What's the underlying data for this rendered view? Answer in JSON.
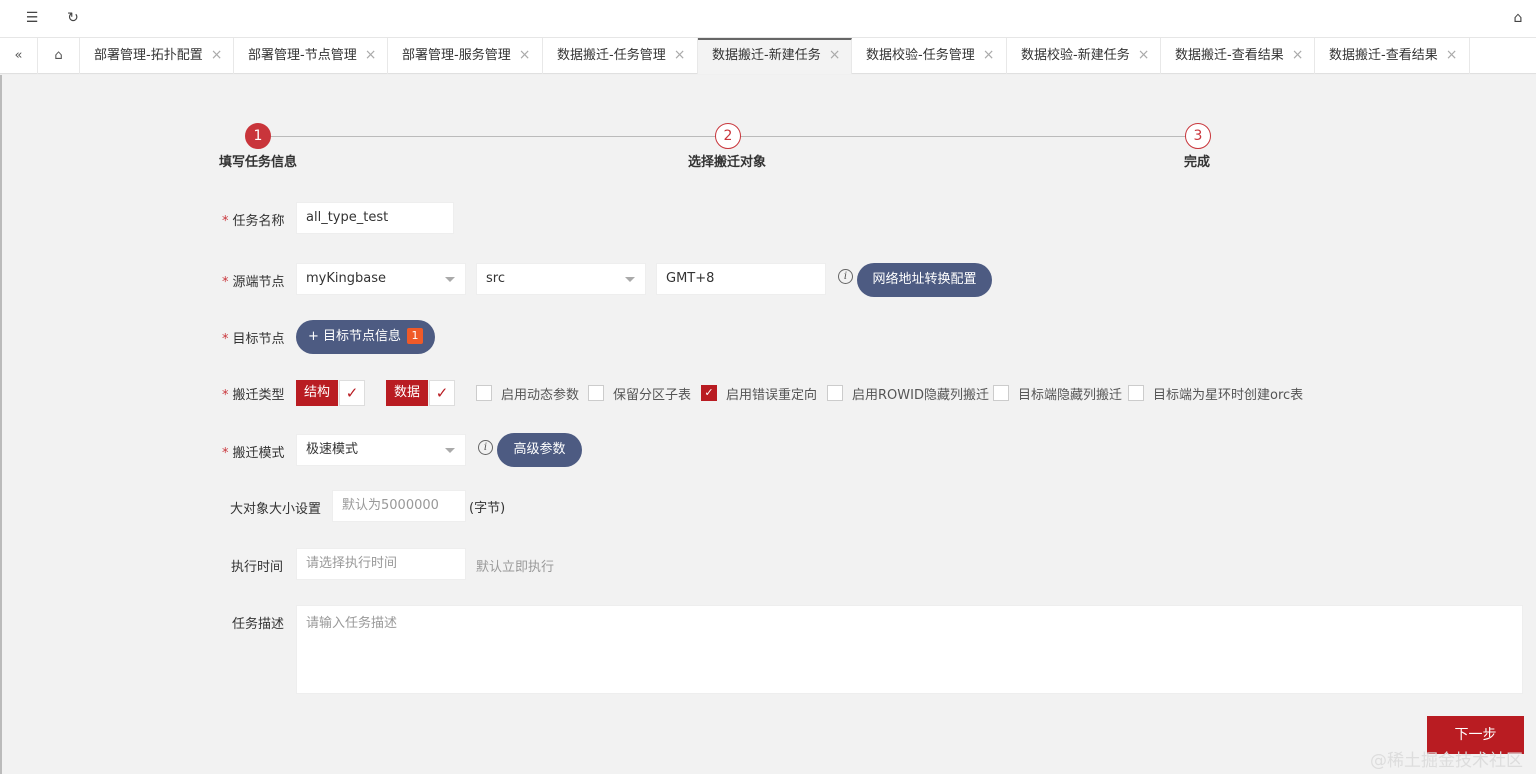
{
  "topbar": {
    "menu_icon": "menu-icon",
    "refresh_icon": "refresh-icon",
    "tag_icon": "tag-icon"
  },
  "tabs": [
    {
      "label": "部署管理-拓扑配置"
    },
    {
      "label": "部署管理-节点管理"
    },
    {
      "label": "部署管理-服务管理"
    },
    {
      "label": "数据搬迁-任务管理"
    },
    {
      "label": "数据搬迁-新建任务",
      "active": true
    },
    {
      "label": "数据校验-任务管理"
    },
    {
      "label": "数据校验-新建任务"
    },
    {
      "label": "数据搬迁-查看结果"
    },
    {
      "label": "数据搬迁-查看结果"
    }
  ],
  "tab_close": "×",
  "steps": [
    {
      "num": "1",
      "label": "填写任务信息"
    },
    {
      "num": "2",
      "label": "选择搬迁对象"
    },
    {
      "num": "3",
      "label": "完成"
    }
  ],
  "form": {
    "required_mark": "*",
    "task_name_label": "任务名称",
    "task_name_value": "all_type_test",
    "source_label": "源端节点",
    "source_node": "myKingbase",
    "source_db": "src",
    "source_tz": "GMT+8",
    "net_config_btn": "网络地址转换配置",
    "target_label": "目标节点",
    "target_btn": "目标节点信息",
    "target_badge": "1",
    "migrate_type_label": "搬迁类型",
    "type_struct": "结构",
    "type_data": "数据",
    "options": [
      {
        "label": "启用动态参数",
        "checked": false
      },
      {
        "label": "保留分区子表",
        "checked": false
      },
      {
        "label": "启用错误重定向",
        "checked": true
      },
      {
        "label": "启用ROWID隐藏列搬迁",
        "checked": false
      },
      {
        "label": "目标端隐藏列搬迁",
        "checked": false
      },
      {
        "label": "目标端为星环时创建orc表",
        "checked": false
      }
    ],
    "mode_label": "搬迁模式",
    "mode_value": "极速模式",
    "advanced_btn": "高级参数",
    "lob_label": "大对象大小设置",
    "lob_placeholder": "默认为5000000",
    "lob_unit": "(字节)",
    "exec_label": "执行时间",
    "exec_placeholder": "请选择执行时间",
    "exec_hint": "默认立即执行",
    "desc_label": "任务描述",
    "desc_placeholder": "请输入任务描述"
  },
  "next_btn": "下一步",
  "watermark": "@稀土掘金技术社区",
  "colors": {
    "primary": "#b91c22",
    "step": "#c9353b",
    "pill": "#4d5b82"
  }
}
